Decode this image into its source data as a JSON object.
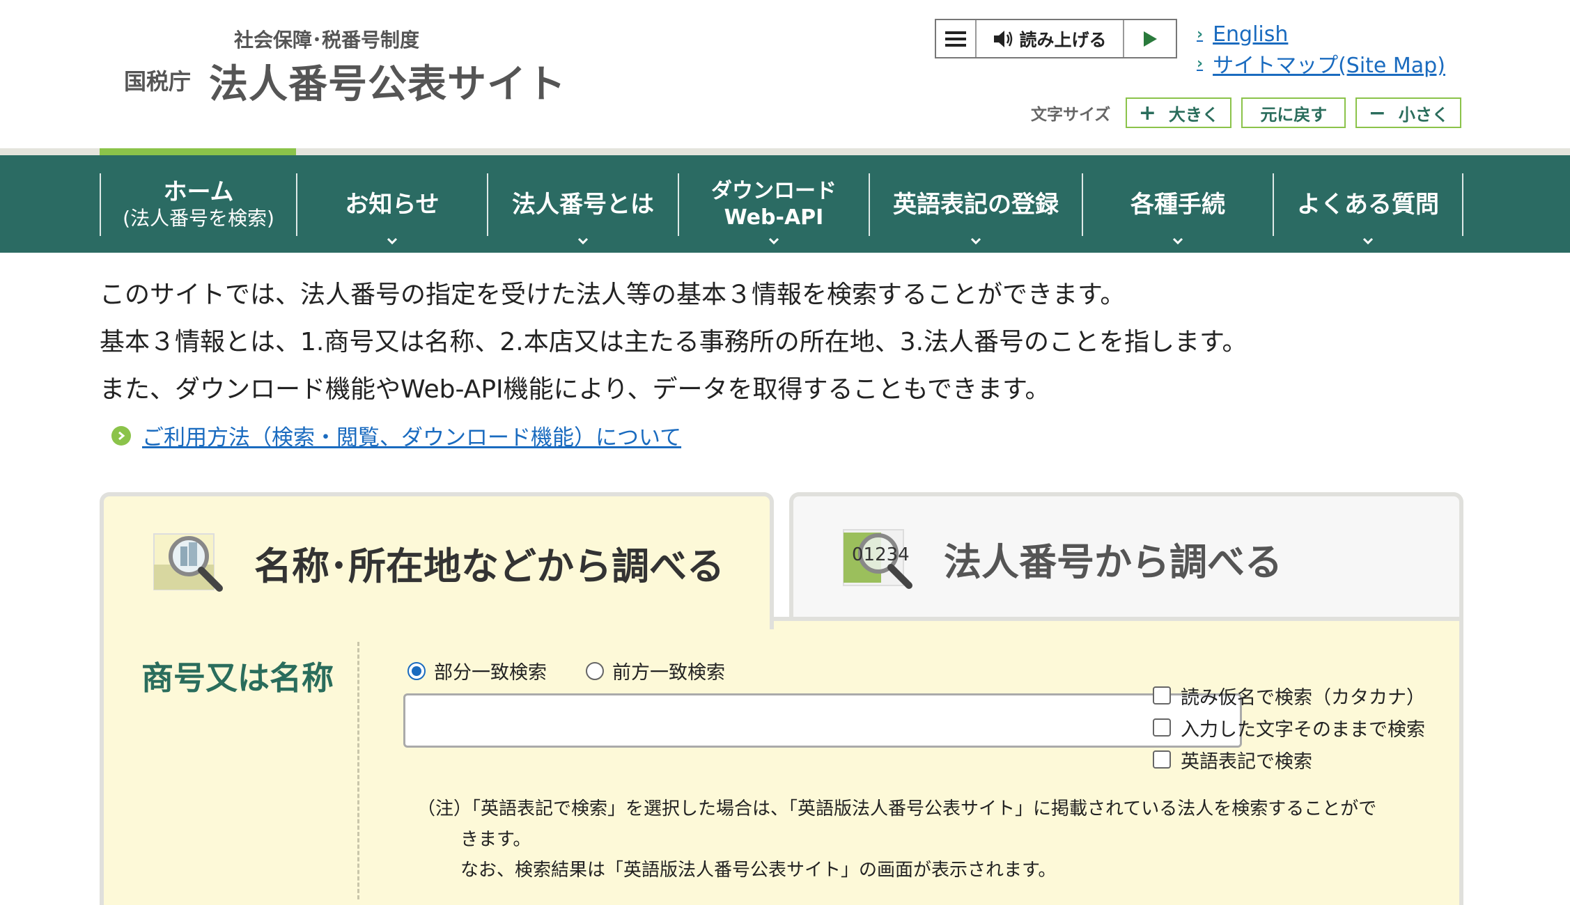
{
  "header": {
    "logo_sub": "社会保障･税番号制度",
    "logo_agency": "国税庁",
    "logo_main": "法人番号公表サイト",
    "read_aloud": {
      "read_label": "読み上げる",
      "menu_icon": "hamburger-icon",
      "speaker_icon": "speaker-icon",
      "play_icon": "play-icon"
    },
    "links": [
      {
        "label": "English"
      },
      {
        "label": "サイトマップ(Site Map)"
      }
    ],
    "font_size": {
      "label": "文字サイズ",
      "larger_symbol": "+",
      "larger": "大きく",
      "reset": "元に戻す",
      "smaller_symbol": "−",
      "smaller": "小さく"
    }
  },
  "nav": {
    "items": [
      {
        "line1": "ホーム",
        "line2": "(法人番号を検索)"
      },
      {
        "line1": "お知らせ"
      },
      {
        "line1": "法人番号とは"
      },
      {
        "line1": "ダウンロード",
        "line2": "Web-API"
      },
      {
        "line1": "英語表記の登録"
      },
      {
        "line1": "各種手続"
      },
      {
        "line1": "よくある質問"
      }
    ]
  },
  "intro": {
    "lines": [
      "このサイトでは、法人番号の指定を受けた法人等の基本３情報を検索することができます。",
      "基本３情報とは、1.商号又は名称、2.本店又は主たる事務所の所在地、3.法人番号のことを指します。",
      "また、ダウンロード機能やWeb-API機能により、データを取得することもできます。"
    ],
    "usage_link": "ご利用方法（検索・閲覧、ダウンロード機能）について"
  },
  "tabs": [
    {
      "label": "名称･所在地などから調べる",
      "icon": "search-building-icon",
      "active": true
    },
    {
      "label": "法人番号から調べる",
      "icon": "search-number-icon",
      "icon_text": "01234",
      "active": false
    }
  ],
  "search_form": {
    "field_label": "商号又は名称",
    "match_options": [
      {
        "label": "部分一致検索",
        "selected": true
      },
      {
        "label": "前方一致検索",
        "selected": false
      }
    ],
    "name_value": "",
    "checkboxes": [
      {
        "label": "読み仮名で検索（カタカナ）",
        "checked": false
      },
      {
        "label": "入力した文字そのままで検索",
        "checked": false
      },
      {
        "label": "英語表記で検索",
        "checked": false
      }
    ],
    "note": {
      "line1": "（注）「英語表記で検索」を選択した場合は、「英語版法人番号公表サイト」に掲載されている法人を検索することがで",
      "line2": "きます。",
      "line3": "なお、検索結果は「英語版法人番号公表サイト」の画面が表示されます。"
    }
  },
  "colors": {
    "nav_bg": "#2b6b63",
    "accent_green": "#8bc34a",
    "panel_bg": "#fdf9d8",
    "link_blue": "#1a6bbf",
    "label_green": "#2a6d5c"
  }
}
